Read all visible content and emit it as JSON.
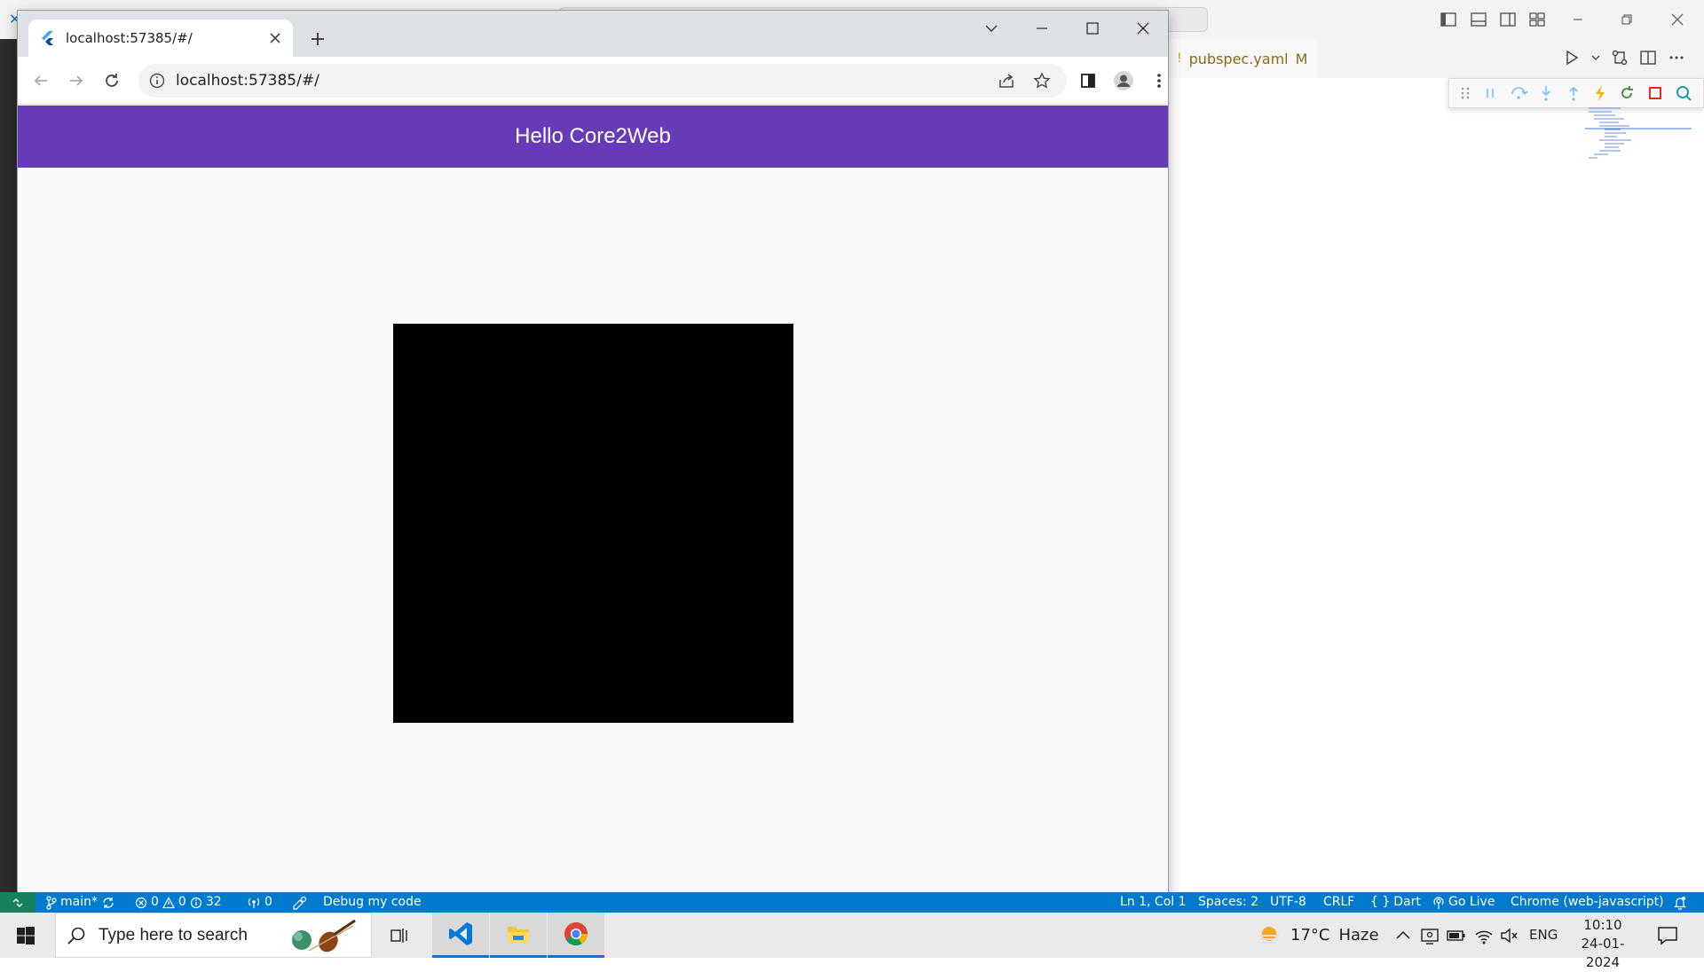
{
  "vscode": {
    "tab_filename": "pubspec.yaml",
    "tab_status": "M",
    "statusbar": {
      "branch": "main*",
      "errors": "0",
      "warnings": "0",
      "info": "32",
      "ports": "0",
      "debug_label": "Debug my code",
      "cursor": "Ln 1, Col 1",
      "spaces": "Spaces: 2",
      "encoding": "UTF-8",
      "eol": "CRLF",
      "language": "Dart",
      "golive": "Go Live",
      "device": "Chrome (web-javascript)"
    }
  },
  "chrome": {
    "tab_title": "localhost:57385/#/",
    "url": "localhost:57385/#/"
  },
  "app": {
    "title": "Hello Core2Web",
    "box_color": "#000000",
    "appbar_color": "#673ab7"
  },
  "taskbar": {
    "search_placeholder": "Type here to search",
    "weather_temp": "17°C",
    "weather_desc": "Haze",
    "language": "ENG",
    "time": "10:10",
    "date": "24-01-2024"
  }
}
